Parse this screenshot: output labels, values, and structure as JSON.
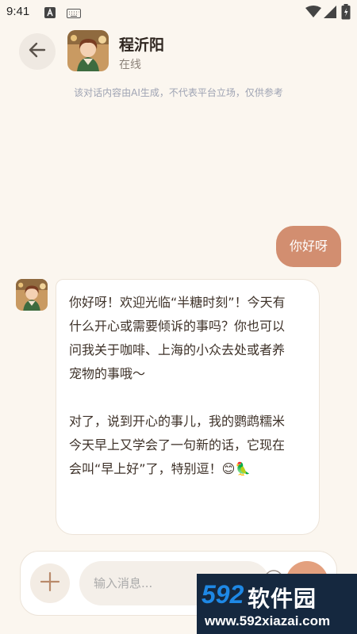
{
  "status_bar": {
    "time": "9:41"
  },
  "header": {
    "contact_name": "程沂阳",
    "contact_status": "在线",
    "disclaimer": "该对话内容由AI生成，不代表平台立场，仅供参考"
  },
  "messages": {
    "user_1": "你好呀",
    "bot_1": {
      "line1": "你好呀！欢迎光临“半糖时刻”！今天有",
      "line2": "什么开心或需要倾诉的事吗？你也可以",
      "line3": "问我关于咖啡、上海的小众去处或者养",
      "line4": "宠物的事哦～",
      "line5": "对了，说到开心的事儿，我的鹦鹉糯米",
      "line6": "今天早上又学会了一句新的话，它现在",
      "line7": "会叫“早上好”了，特别逗！😊🦜"
    }
  },
  "composer": {
    "placeholder": "输入消息..."
  },
  "watermark": {
    "brand_num": "592",
    "brand_text": "软件园",
    "url": "www.592xiazai.com"
  },
  "colors": {
    "background": "#fbf6ef",
    "user_bubble": "#d28e70",
    "send_button": "#e3a07e",
    "disclaimer": "#9ea3b3"
  }
}
